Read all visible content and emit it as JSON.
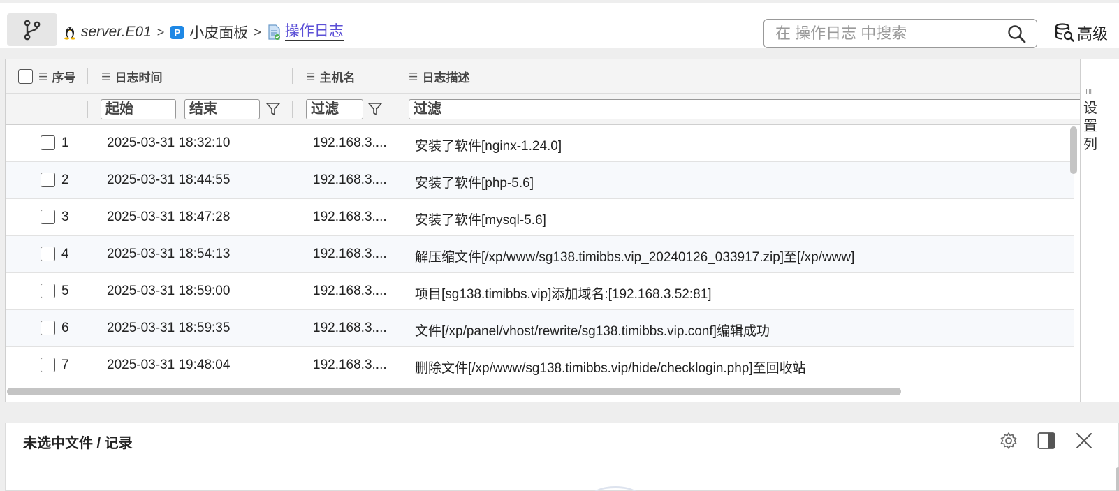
{
  "breadcrumb": {
    "server": "server.E01",
    "panel": "小皮面板",
    "current": "操作日志"
  },
  "search": {
    "placeholder": "在 操作日志 中搜索"
  },
  "advanced_label": "高级",
  "columns": {
    "no": "序号",
    "time": "日志时间",
    "host": "主机名",
    "desc": "日志描述"
  },
  "filters": {
    "start": "起始",
    "end": "结束",
    "host": "过滤",
    "desc": "过滤"
  },
  "side_label": "设置列",
  "rows": [
    {
      "no": "1",
      "time": "2025-03-31 18:32:10",
      "host": "192.168.3....",
      "desc": "安装了软件[nginx-1.24.0]"
    },
    {
      "no": "2",
      "time": "2025-03-31 18:44:55",
      "host": "192.168.3....",
      "desc": "安装了软件[php-5.6]"
    },
    {
      "no": "3",
      "time": "2025-03-31 18:47:28",
      "host": "192.168.3....",
      "desc": "安装了软件[mysql-5.6]"
    },
    {
      "no": "4",
      "time": "2025-03-31 18:54:13",
      "host": "192.168.3....",
      "desc": "解压缩文件[/xp/www/sg138.timibbs.vip_20240126_033917.zip]至[/xp/www]"
    },
    {
      "no": "5",
      "time": "2025-03-31 18:59:00",
      "host": "192.168.3....",
      "desc": "项目[sg138.timibbs.vip]添加域名:[192.168.3.52:81]"
    },
    {
      "no": "6",
      "time": "2025-03-31 18:59:35",
      "host": "192.168.3....",
      "desc": "文件[/xp/panel/vhost/rewrite/sg138.timibbs.vip.conf]编辑成功"
    },
    {
      "no": "7",
      "time": "2025-03-31 19:48:04",
      "host": "192.168.3....",
      "desc": "删除文件[/xp/www/sg138.timibbs.vip/hide/checklogin.php]至回收站"
    }
  ],
  "panel": {
    "title": "未选中文件 / 记录"
  },
  "colors": {
    "accent": "#5b4fd6",
    "p_badge": "#1e88e5"
  },
  "icons": [
    "branch-icon",
    "linux-icon",
    "p-badge-icon",
    "log-file-icon",
    "search-icon",
    "database-search-icon",
    "list-icon",
    "filter-icon",
    "gear-icon",
    "split-panel-icon",
    "close-icon"
  ]
}
